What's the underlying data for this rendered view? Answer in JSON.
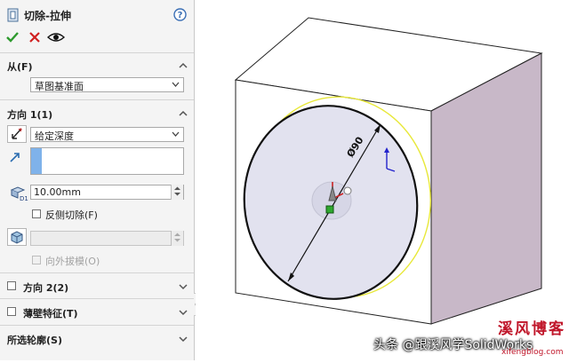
{
  "feature": {
    "title": "切除-拉伸",
    "help_icon": "help-icon"
  },
  "actions": {
    "ok_icon": "checkmark-icon",
    "cancel_icon": "x-icon",
    "preview_icon": "eye-icon"
  },
  "from_section": {
    "label": "从(F)",
    "start_condition": "草图基准面"
  },
  "direction1": {
    "label": "方向 1(1)",
    "end_condition": "给定深度",
    "depth": "10.00mm",
    "flip_side_label": "反侧切除(F)",
    "draft_outward_label": "向外拔模(O)"
  },
  "direction2": {
    "label": "方向 2(2)"
  },
  "thin_feature": {
    "label": "薄壁特征(T)"
  },
  "selected_contours": {
    "label": "所选轮廓(S)"
  },
  "graphics": {
    "dimension_label": "Ø90",
    "colors": {
      "front_face": "#ffffff",
      "right_face": "#c8b8c8",
      "circle_fill": "#e2e2ef",
      "preview_ring": "#e8e83a"
    }
  },
  "watermark": {
    "toutiao": "头条 @跟溪风学SolidWorks",
    "blog_name": "溪风博客",
    "site": "xifengblog.com"
  }
}
